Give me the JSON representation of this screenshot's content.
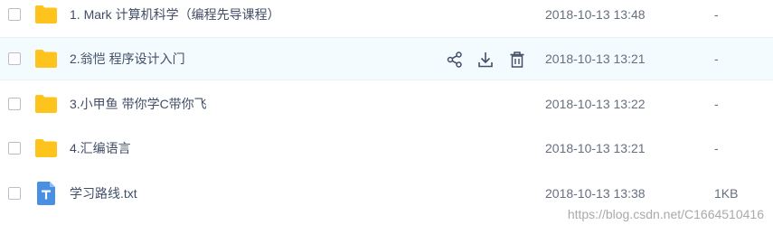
{
  "files": [
    {
      "name": "1. Mark 计算机科学（编程先导课程）",
      "date": "2018-10-13 13:48",
      "size": "-",
      "type": "folder-icon"
    },
    {
      "name": "2.翁恺 程序设计入门",
      "date": "2018-10-13 13:21",
      "size": "-",
      "type": "folder-icon"
    },
    {
      "name": "3.小甲鱼 带你学C带你飞",
      "date": "2018-10-13 13:22",
      "size": "-",
      "type": "folder-icon"
    },
    {
      "name": "4.汇编语言",
      "date": "2018-10-13 13:21",
      "size": "-",
      "type": "folder-icon"
    },
    {
      "name": "学习路线.txt",
      "date": "2018-10-13 13:38",
      "size": "1KB",
      "type": "txt-file-icon"
    }
  ],
  "row_actions": [
    "share-icon",
    "download-icon",
    "delete-icon"
  ],
  "colors": {
    "folder": "#ffc31d",
    "file": "#4a90e2",
    "hover_row": "#f4fbff",
    "text": "#424e67",
    "action_icon": "#424e67"
  },
  "watermark": "https://blog.csdn.net/C1664510416"
}
